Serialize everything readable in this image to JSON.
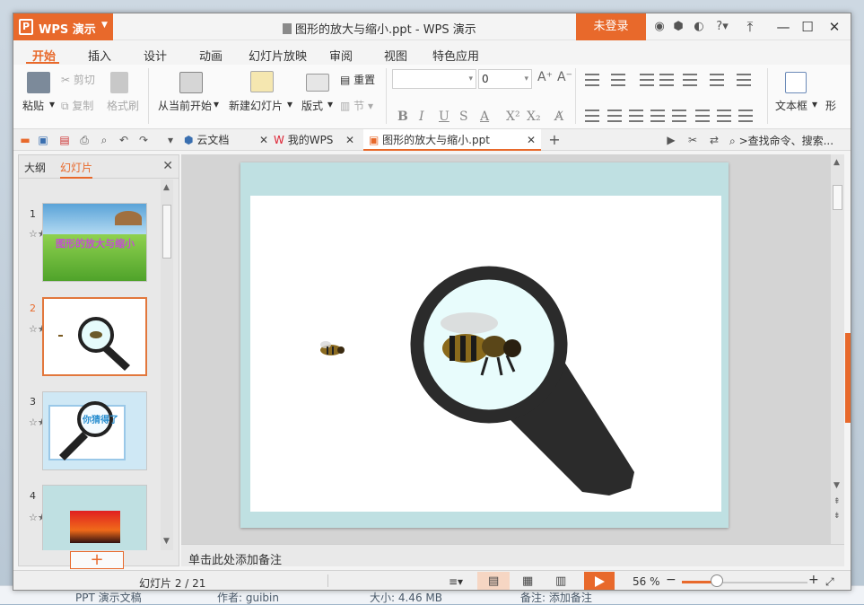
{
  "app": {
    "name": "WPS 演示",
    "logo_letter": "P",
    "document_title": "图形的放大与缩小.ppt - WPS 演示",
    "login_label": "未登录",
    "help_label": "?"
  },
  "ribbon_tabs": [
    "开始",
    "插入",
    "设计",
    "动画",
    "幻灯片放映",
    "审阅",
    "视图",
    "特色应用"
  ],
  "active_tab": "开始",
  "ribbon": {
    "paste": "粘贴",
    "cut": "剪切",
    "copy": "复制",
    "format_painter": "格式刷",
    "from_current": "从当前开始",
    "new_slide": "新建幻灯片",
    "reset": "重置",
    "layout": "版式",
    "section": "节",
    "font_size": "0",
    "text_box": "文本框",
    "shape": "形"
  },
  "doc_tabs": [
    {
      "label": "云文档",
      "icon": "cloud-doc-icon"
    },
    {
      "label": "我的WPS",
      "icon": "wps-logo-icon"
    },
    {
      "label": "图形的放大与缩小.ppt",
      "icon": "ppt-file-icon",
      "active": true
    }
  ],
  "search_label": ">查找命令、搜索...",
  "left_pane": {
    "tab_outline": "大纲",
    "tab_slides": "幻灯片",
    "thumbs": [
      {
        "num": "1",
        "title": "图形的放大与缩小"
      },
      {
        "num": "2",
        "title": ""
      },
      {
        "num": "3",
        "title": "你猜得了"
      },
      {
        "num": "4",
        "title": ""
      }
    ],
    "add_label": "+"
  },
  "notes_placeholder": "单击此处添加备注",
  "status": {
    "slide_info": "幻灯片 2 / 21",
    "zoom": "56 %",
    "zoom_fraction": 0.28
  },
  "explorer": {
    "type": "PPT 演示文稿",
    "author": "作者: guibin",
    "size": "大小: 4.46 MB",
    "note": "备注: 添加备注"
  },
  "colors": {
    "accent": "#e8692b",
    "slide_frame": "#bfe0e2"
  }
}
